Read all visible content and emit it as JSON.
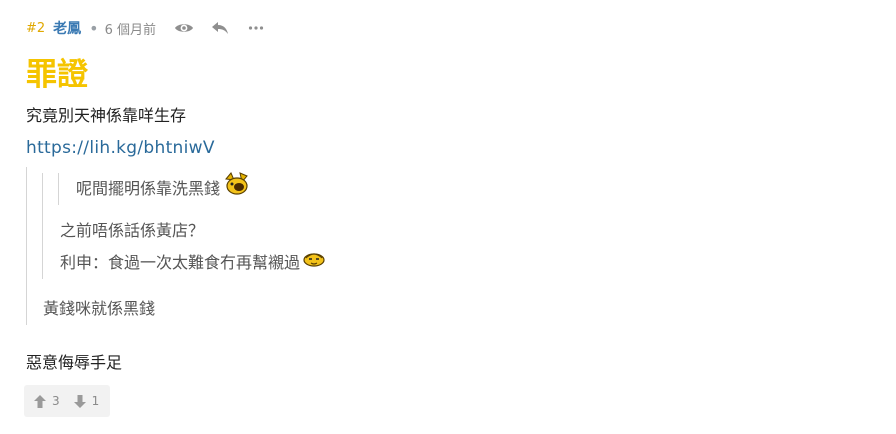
{
  "post": {
    "floor": "#2",
    "username": "老鳳",
    "separator": "•",
    "time": "6 個月前",
    "actions": {
      "view_icon": "eye-icon",
      "reply_icon": "reply-icon",
      "more_icon": "more-icon"
    },
    "title": "罪證",
    "line1": "究竟別天神係靠咩生存",
    "link": "https://lih.kg/bhtniwV",
    "quote": {
      "lv3": "呢間擺明係靠洗黑錢",
      "lv2_line1": "之前唔係話係黃店？",
      "lv2_line2": "利申：食過一次太難食冇再幫襯過",
      "lv1": "黃錢咪就係黑錢"
    },
    "closing": "惡意侮辱手足"
  },
  "votes": {
    "up_icon": "arrow-up-icon",
    "up_count": "3",
    "down_icon": "arrow-down-icon",
    "down_count": "1"
  },
  "colors": {
    "title": "#f5c400",
    "username": "#3b7ab3",
    "floor": "#e0a800",
    "link": "#2a6a9a"
  }
}
